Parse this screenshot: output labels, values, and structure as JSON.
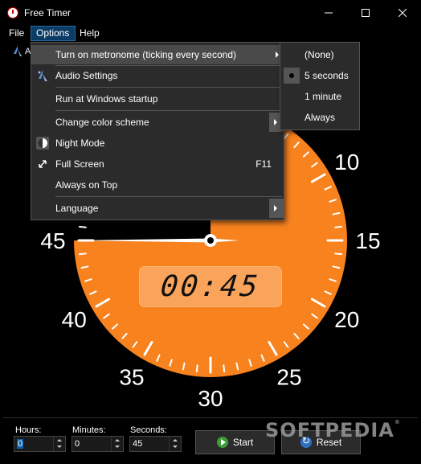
{
  "window": {
    "title": "Free Timer"
  },
  "menubar": {
    "file": "File",
    "options": "Options",
    "help": "Help"
  },
  "toolbar": {
    "partial_label": "A"
  },
  "options_menu": {
    "items": [
      {
        "label": "Turn on metronome (ticking every second)",
        "submenu": true
      },
      {
        "label": "Audio Settings"
      },
      {
        "label": "Run at Windows startup"
      },
      {
        "label": "Change color scheme",
        "submenu": true
      },
      {
        "label": "Night Mode"
      },
      {
        "label": "Full Screen",
        "shortcut": "F11"
      },
      {
        "label": "Always on Top"
      },
      {
        "label": "Language",
        "submenu": true
      }
    ]
  },
  "metronome_submenu": {
    "items": [
      {
        "label": "(None)"
      },
      {
        "label": "5 seconds",
        "selected": true
      },
      {
        "label": "1 minute"
      },
      {
        "label": "Always"
      }
    ]
  },
  "clock": {
    "numbers": [
      "10",
      "15",
      "20",
      "25",
      "30",
      "35",
      "40",
      "45"
    ],
    "digital": "00:45",
    "remaining_seconds": 45,
    "face_color": "#f7821e"
  },
  "controls": {
    "hours_label": "Hours:",
    "hours_value": "0",
    "minutes_label": "Minutes:",
    "minutes_value": "0",
    "seconds_label": "Seconds:",
    "seconds_value": "45",
    "start_label": "Start",
    "reset_label": "Reset"
  },
  "watermark": "SOFTPEDIA"
}
